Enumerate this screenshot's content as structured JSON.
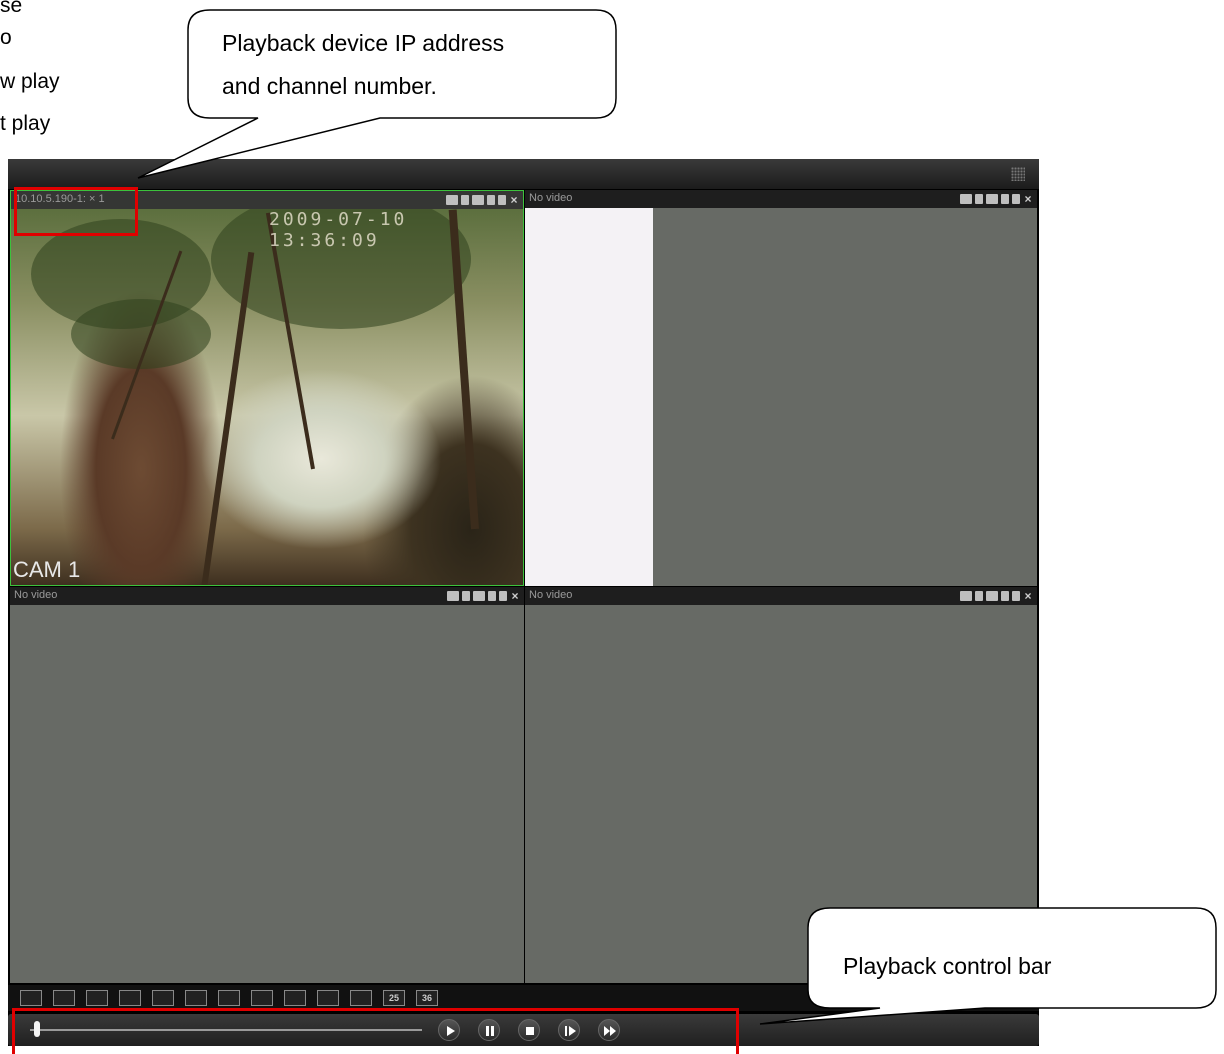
{
  "doc_fragments": [
    "se",
    "o",
    "w play",
    "t play"
  ],
  "callouts": {
    "top": [
      "Playback device IP address",
      "and channel number."
    ],
    "bottom": "Playback control bar"
  },
  "panes": [
    {
      "label": "10.10.5.190-1: × 1",
      "overlay_timestamp": "2009-07-10 13:36:09",
      "overlay_cam": "CAM 1"
    },
    {
      "label": "No video"
    },
    {
      "label": "No video"
    },
    {
      "label": "No video"
    }
  ],
  "layout_buttons": [
    "",
    "",
    "",
    "",
    "",
    "",
    "",
    "",
    "",
    "",
    "",
    "25",
    "36"
  ],
  "playback": {
    "progress": 0.01
  },
  "colors": {
    "highlight": "#e00000",
    "active_border": "#3cc23c",
    "pane_bg": "#676a65"
  }
}
